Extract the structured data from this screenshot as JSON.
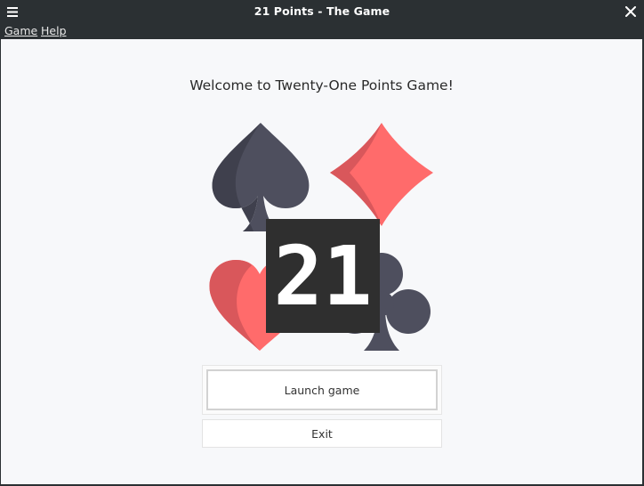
{
  "window": {
    "title": "21 Points - The Game",
    "menu_icon": "hamburger-menu-icon",
    "close_icon": "close-icon"
  },
  "menubar": {
    "items": [
      {
        "label": "Game"
      },
      {
        "label": "Help"
      }
    ]
  },
  "main": {
    "welcome_text": "Welcome to Twenty-One Points Game!",
    "logo": {
      "text": "21",
      "suits": [
        "spade-icon",
        "diamond-icon",
        "heart-icon",
        "club-icon"
      ],
      "colors": {
        "dark_suit": "#4e4f5e",
        "dark_suit_shade": "#3f404d",
        "red_suit": "#ff6b6b",
        "red_suit_shade": "#d9575b",
        "badge_bg": "#2f2f2f",
        "badge_text": "#ffffff"
      }
    },
    "launch_button": "Launch game",
    "exit_button": "Exit"
  },
  "colors": {
    "titlebar_bg": "#2b3033",
    "content_bg": "#f7f8fa"
  }
}
